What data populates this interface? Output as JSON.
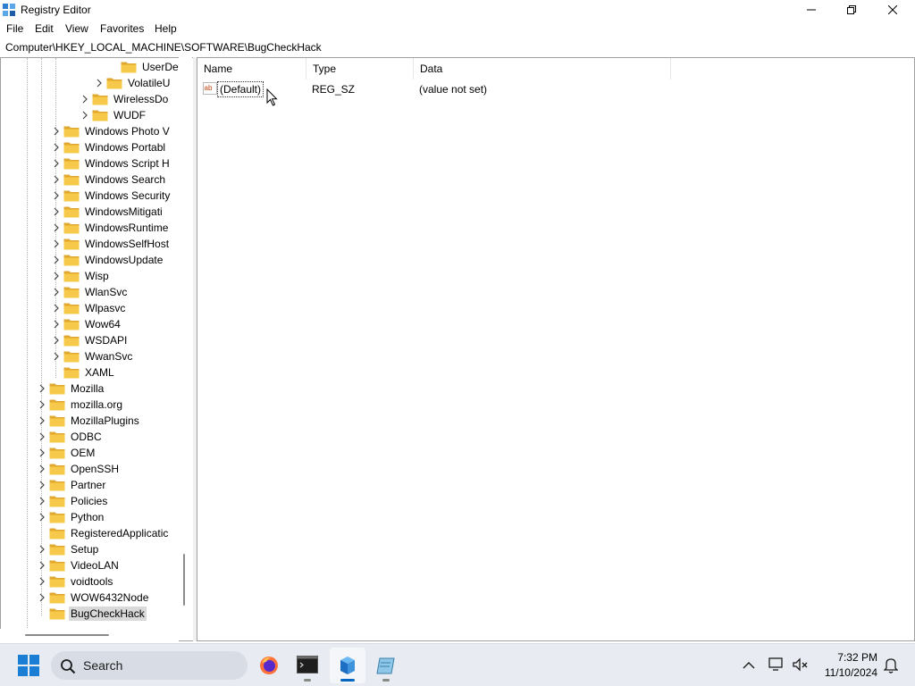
{
  "window": {
    "title": "Registry Editor"
  },
  "menu": [
    "File",
    "Edit",
    "View",
    "Favorites",
    "Help"
  ],
  "address": "Computer\\HKEY_LOCAL_MACHINE\\SOFTWARE\\BugCheckHack",
  "tree": [
    {
      "label": "UserDefi",
      "chevron": false
    },
    {
      "label": "VolatileU",
      "chevron": true
    },
    {
      "label": "WirelessDo",
      "chevron": true
    },
    {
      "label": "WUDF",
      "chevron": true
    },
    {
      "label": "Windows Photo V",
      "chevron": true
    },
    {
      "label": "Windows Portabl",
      "chevron": true
    },
    {
      "label": "Windows Script H",
      "chevron": true
    },
    {
      "label": "Windows Search",
      "chevron": true
    },
    {
      "label": "Windows Security",
      "chevron": true
    },
    {
      "label": "WindowsMitigati",
      "chevron": true
    },
    {
      "label": "WindowsRuntime",
      "chevron": true
    },
    {
      "label": "WindowsSelfHost",
      "chevron": true
    },
    {
      "label": "WindowsUpdate",
      "chevron": true
    },
    {
      "label": "Wisp",
      "chevron": true
    },
    {
      "label": "WlanSvc",
      "chevron": true
    },
    {
      "label": "Wlpasvc",
      "chevron": true
    },
    {
      "label": "Wow64",
      "chevron": true
    },
    {
      "label": "WSDAPI",
      "chevron": true
    },
    {
      "label": "WwanSvc",
      "chevron": true
    },
    {
      "label": "XAML",
      "chevron": false
    },
    {
      "label": "Mozilla",
      "chevron": true
    },
    {
      "label": "mozilla.org",
      "chevron": true
    },
    {
      "label": "MozillaPlugins",
      "chevron": true
    },
    {
      "label": "ODBC",
      "chevron": true
    },
    {
      "label": "OEM",
      "chevron": true
    },
    {
      "label": "OpenSSH",
      "chevron": true
    },
    {
      "label": "Partner",
      "chevron": true
    },
    {
      "label": "Policies",
      "chevron": true
    },
    {
      "label": "Python",
      "chevron": true
    },
    {
      "label": "RegisteredApplicatic",
      "chevron": false
    },
    {
      "label": "Setup",
      "chevron": true
    },
    {
      "label": "VideoLAN",
      "chevron": true
    },
    {
      "label": "voidtools",
      "chevron": true
    },
    {
      "label": "WOW6432Node",
      "chevron": true
    },
    {
      "label": "BugCheckHack",
      "chevron": false,
      "selected": true
    }
  ],
  "columns": [
    "Name",
    "Type",
    "Data"
  ],
  "values": [
    {
      "name": "(Default)",
      "type": "REG_SZ",
      "data": "(value not set)"
    }
  ],
  "taskbar": {
    "search_label": "Search",
    "apps": [
      "firefox-icon",
      "terminal-icon",
      "registry-editor-icon",
      "notepad-icon"
    ],
    "time": "7:32 PM",
    "date": "11/10/2024"
  },
  "colors": {
    "folder": "#f6c94a",
    "accent": "#0067c0"
  }
}
